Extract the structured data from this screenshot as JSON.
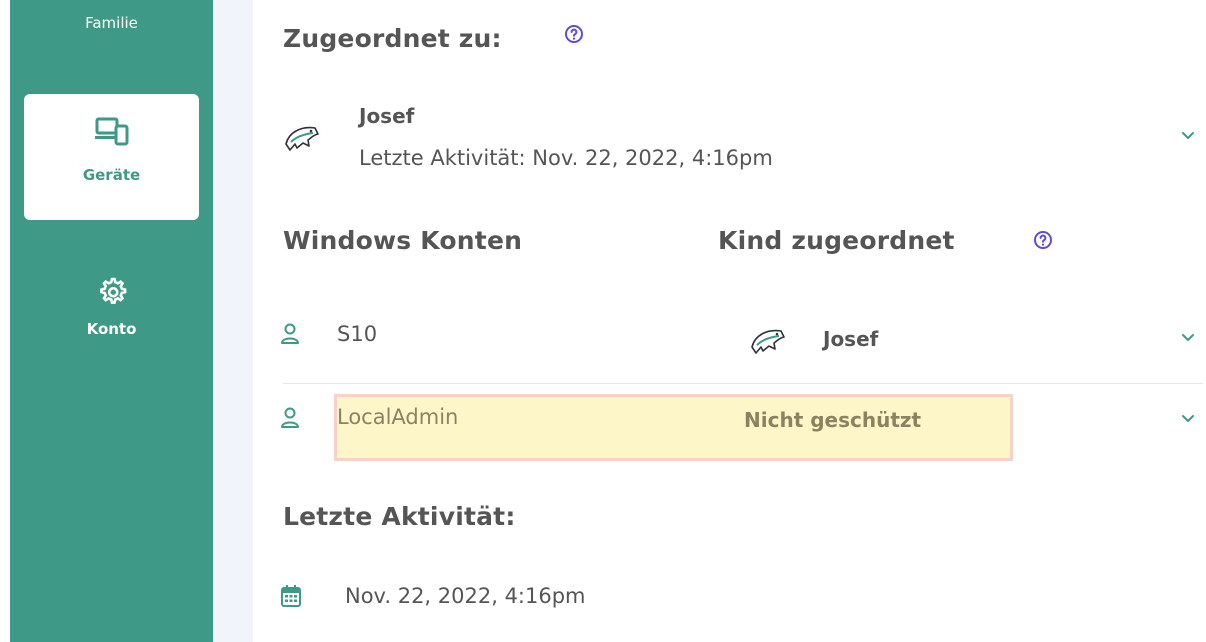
{
  "sidebar": {
    "top_label": "Familie",
    "items": [
      {
        "label": "Geräte",
        "icon": "devices-icon",
        "active": true
      },
      {
        "label": "Konto",
        "icon": "gear-icon",
        "active": false
      }
    ],
    "color": "#3e9a86"
  },
  "assigned": {
    "title": "Zugeordnet zu:",
    "name": "Josef",
    "last_activity": "Letzte Aktivität: Nov. 22, 2022, 4:16pm"
  },
  "accounts": {
    "col_windows": "Windows Konten",
    "col_child": "Kind zugeordnet",
    "rows": [
      {
        "account": "S10",
        "child": "Josef",
        "protected": true
      },
      {
        "account": "LocalAdmin",
        "child": "Nicht geschützt",
        "protected": false
      }
    ]
  },
  "activity": {
    "title": "Letzte Aktivität:",
    "date": "Nov. 22, 2022, 4:16pm"
  }
}
